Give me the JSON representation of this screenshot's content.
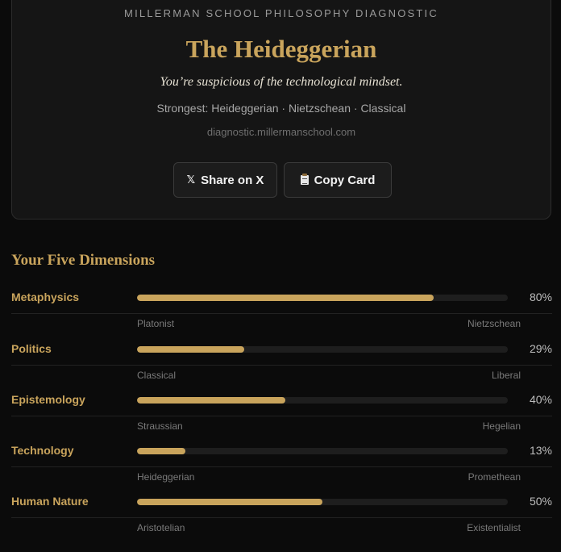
{
  "header": {
    "eyebrow": "MILLERMAN SCHOOL PHILOSOPHY DIAGNOSTIC",
    "title": "The Heideggerian",
    "tagline": "You’re suspicious of the technological mindset.",
    "strongest": "Strongest: Heideggerian · Nietzschean · Classical",
    "site": "diagnostic.millermanschool.com",
    "share_label": "Share on X",
    "copy_label": "Copy Card"
  },
  "colors": {
    "accent": "#c9a45c",
    "background": "#0b0b0b",
    "card": "#151515",
    "track": "#1e1e1e"
  },
  "dimensions_title": "Your Five Dimensions",
  "dimensions": [
    {
      "name": "Metaphysics",
      "value": 80,
      "percent_label": "80%",
      "left_pole": "Platonist",
      "right_pole": "Nietzschean"
    },
    {
      "name": "Politics",
      "value": 29,
      "percent_label": "29%",
      "left_pole": "Classical",
      "right_pole": "Liberal"
    },
    {
      "name": "Epistemology",
      "value": 40,
      "percent_label": "40%",
      "left_pole": "Straussian",
      "right_pole": "Hegelian"
    },
    {
      "name": "Technology",
      "value": 13,
      "percent_label": "13%",
      "left_pole": "Heideggerian",
      "right_pole": "Promethean"
    },
    {
      "name": "Human Nature",
      "value": 50,
      "percent_label": "50%",
      "left_pole": "Aristotelian",
      "right_pole": "Existentialist"
    }
  ]
}
